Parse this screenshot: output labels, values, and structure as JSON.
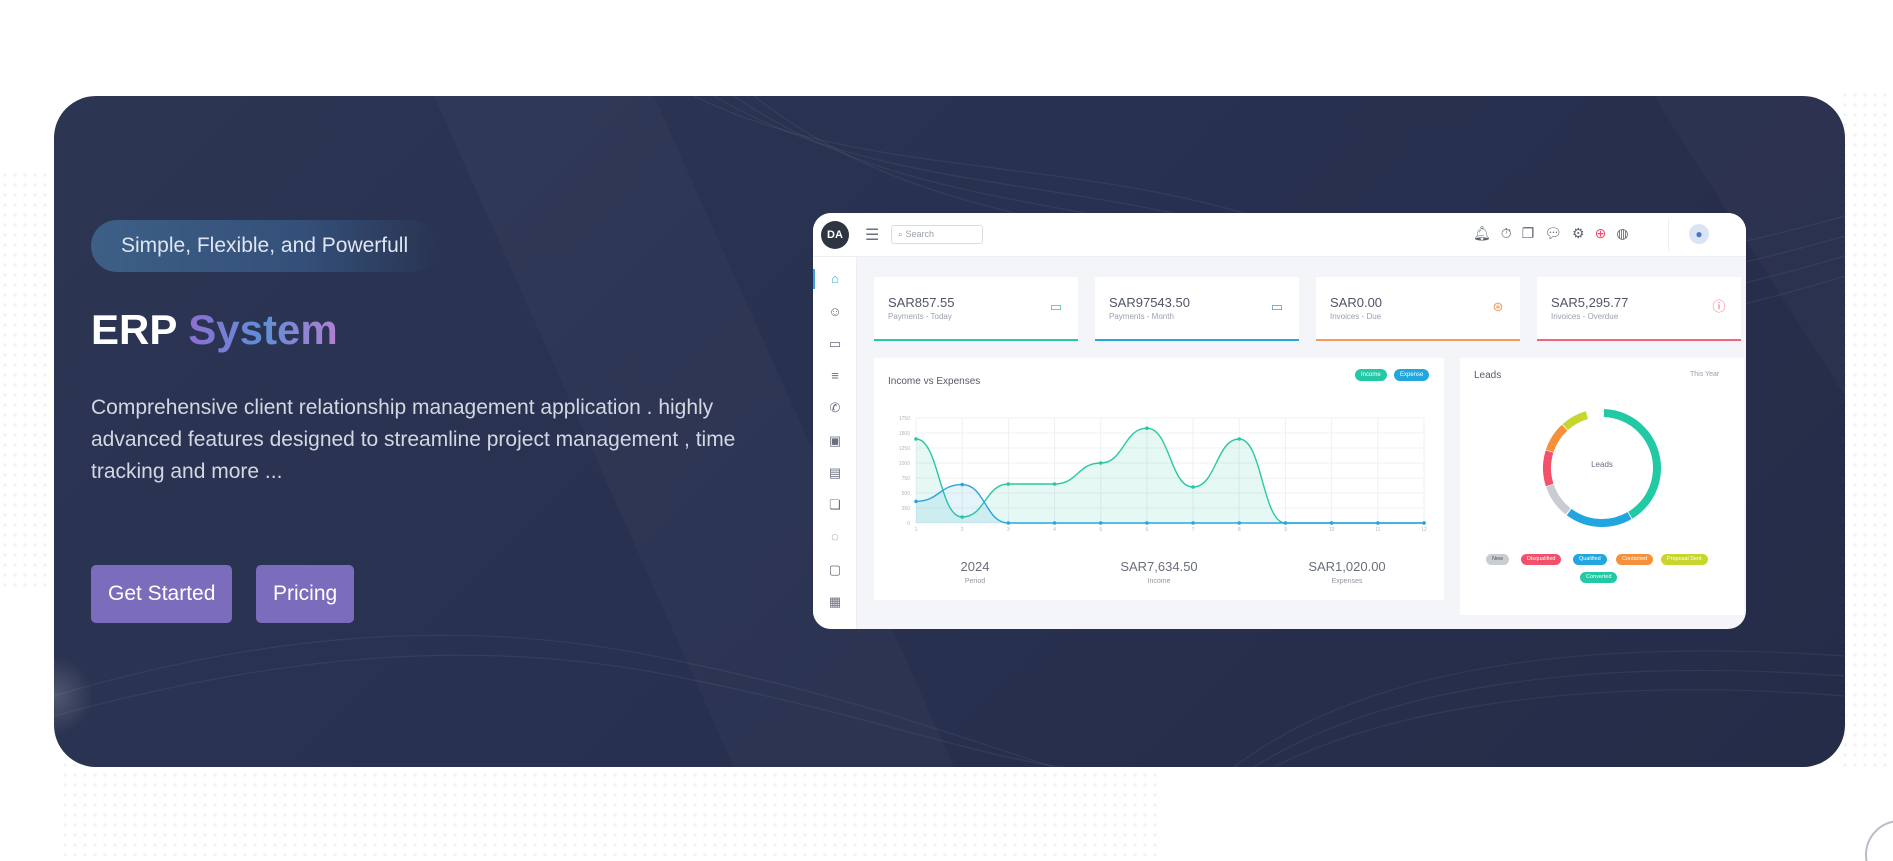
{
  "hero": {
    "tagline": "Simple, Flexible, and Powerfull",
    "title_plain": "ERP",
    "title_accent": "System",
    "description": "Comprehensive client relationship management application . highly advanced features designed to streamline project management , time tracking and more ...",
    "buttons": {
      "get_started": "Get Started",
      "pricing": "Pricing"
    },
    "colors": {
      "background": "#2a3350",
      "button": "#7b6cbc",
      "accent_start": "#8d6fd1",
      "accent_end": "#b27ed2"
    }
  },
  "dashboard": {
    "logo": "DA",
    "search_placeholder": "Search",
    "topbar_icons": [
      "bell-icon",
      "timer-icon",
      "windows-icon",
      "chat-icon",
      "gear-icon",
      "plus-circle-icon",
      "globe-icon",
      "user-avatar-icon"
    ],
    "sidebar_icons": [
      "home-icon",
      "users-icon",
      "folder-icon",
      "list-icon",
      "phone-icon",
      "wallet-icon",
      "book-icon",
      "copy-icon",
      "chat-icon",
      "monitor-icon",
      "clipboard-icon"
    ],
    "cards": [
      {
        "value": "SAR857.55",
        "label": "Payments - Today",
        "icon": "card-icon",
        "color": "#2ac7a4"
      },
      {
        "value": "SAR97543.50",
        "label": "Payments - Month",
        "icon": "card-icon",
        "color": "#2aa6db"
      },
      {
        "value": "SAR0.00",
        "label": "Invoices - Due",
        "icon": "dollar-icon",
        "color": "#f59a5a"
      },
      {
        "value": "SAR5,295.77",
        "label": "Invoices - Overdue",
        "icon": "alert-icon",
        "color": "#f2647e"
      }
    ],
    "income_chart": {
      "title": "Income vs Expenses",
      "legend": {
        "income": "Income",
        "expense": "Expense"
      },
      "stats": [
        {
          "value": "2024",
          "label": "Period"
        },
        {
          "value": "SAR7,634.50",
          "label": "Income"
        },
        {
          "value": "SAR1,020.00",
          "label": "Expenses"
        }
      ]
    },
    "leads": {
      "title": "Leads",
      "period": "This Year",
      "center_label": "Leads",
      "legend": [
        {
          "label": "New",
          "color": "#c9ccd3"
        },
        {
          "label": "Disqualified",
          "color": "#f2506b"
        },
        {
          "label": "Qualified",
          "color": "#22a6e0"
        },
        {
          "label": "Contacted",
          "color": "#f7903a"
        },
        {
          "label": "Proposal Sent",
          "color": "#c7d62c"
        },
        {
          "label": "Converted",
          "color": "#22c9a5"
        }
      ]
    }
  },
  "chart_data": {
    "type": "area",
    "title": "Income vs Expenses",
    "x": [
      1,
      2,
      3,
      4,
      5,
      6,
      7,
      8,
      9,
      10,
      11,
      12
    ],
    "ylim": [
      0,
      1750
    ],
    "y_ticks": [
      "0",
      "250",
      "500",
      "750",
      "1000",
      "1250",
      "1500",
      "1750"
    ],
    "series": [
      {
        "name": "Income",
        "color": "#2ac7a4",
        "values": [
          1400,
          100,
          650,
          650,
          1000,
          1580,
          600,
          1400,
          0,
          0,
          0,
          0
        ]
      },
      {
        "name": "Expense",
        "color": "#2aa6db",
        "values": [
          360,
          640,
          0,
          0,
          0,
          0,
          0,
          0,
          0,
          0,
          0,
          0
        ]
      }
    ]
  }
}
